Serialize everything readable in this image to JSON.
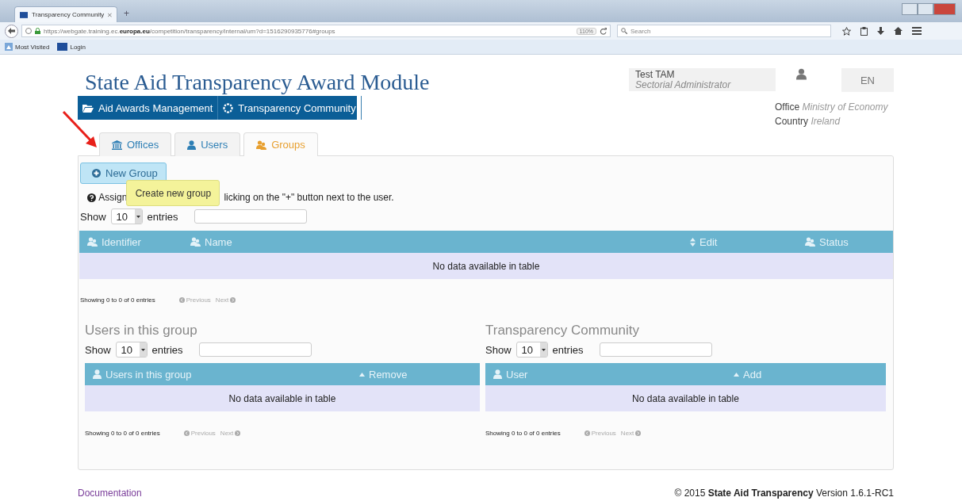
{
  "browser": {
    "tab_title": "Transparency Community",
    "new_tab": "+",
    "url": "https://webgate.training.ec.**europa.eu**/competition/transparency/internal/um?d=1516290935776#groups",
    "zoom": "110%",
    "search_placeholder": "Search",
    "bookmarks": [
      {
        "label": "Most Visited",
        "kind": "folder"
      },
      {
        "label": "Login",
        "kind": "flag"
      }
    ]
  },
  "header": {
    "title": "State Aid Transparency Award Module",
    "nav": [
      {
        "label": "Aid Awards Management",
        "kind": "folder"
      },
      {
        "label": "Transparency Community",
        "kind": "lifebuoy"
      }
    ],
    "user": {
      "name": "Test TAM",
      "role": "Sectorial Administrator"
    },
    "language": "EN",
    "office": {
      "label": "Office",
      "value": "Ministry of Economy"
    },
    "country": {
      "label": "Country",
      "value": "Ireland"
    }
  },
  "tabs": [
    {
      "label": "Offices",
      "kind": "bank",
      "selected": false
    },
    {
      "label": "Users",
      "kind": "user",
      "selected": false
    },
    {
      "label": "Groups",
      "kind": "group",
      "selected": true
    }
  ],
  "new_group_button": "New Group",
  "tooltip": "Create new group",
  "info": {
    "start": "Assign",
    "end": "licking on the \"+\" button next to the user."
  },
  "groups_table": {
    "show": "Show",
    "length": "10",
    "entries": "entries",
    "columns": [
      {
        "label": "Identifier",
        "kind": "group"
      },
      {
        "label": "Name",
        "kind": "group"
      },
      {
        "label": "Edit",
        "kind": "sort"
      },
      {
        "label": "Status",
        "kind": "group"
      }
    ],
    "empty": "No data available in table",
    "summary": "Showing 0 to 0 of 0 entries",
    "previous": "Previous",
    "next": "Next",
    "pager_disabled": true
  },
  "users_in_group": {
    "heading": "Users in this group",
    "show": "Show",
    "length": "10",
    "entries": "entries",
    "columns": [
      {
        "label": "Users in this group",
        "kind": "user"
      },
      {
        "label": "Remove",
        "kind": "caret"
      }
    ],
    "empty": "No data available in table",
    "summary": "Showing 0 to 0 of 0 entries",
    "previous": "Previous",
    "next": "Next",
    "pager_disabled": true
  },
  "transparency_community": {
    "heading": "Transparency Community",
    "show": "Show",
    "length": "10",
    "entries": "entries",
    "columns": [
      {
        "label": "User",
        "kind": "user"
      },
      {
        "label": "Add",
        "kind": "caret"
      }
    ],
    "empty": "No data available in table",
    "summary": "Showing 0 to 0 of 0 entries",
    "previous": "Previous",
    "next": "Next",
    "pager_disabled": true
  },
  "footer": {
    "documentation": "Documentation",
    "copyright": "© 2015 **State Aid Transparency** Version 1.6.1-RC1"
  }
}
